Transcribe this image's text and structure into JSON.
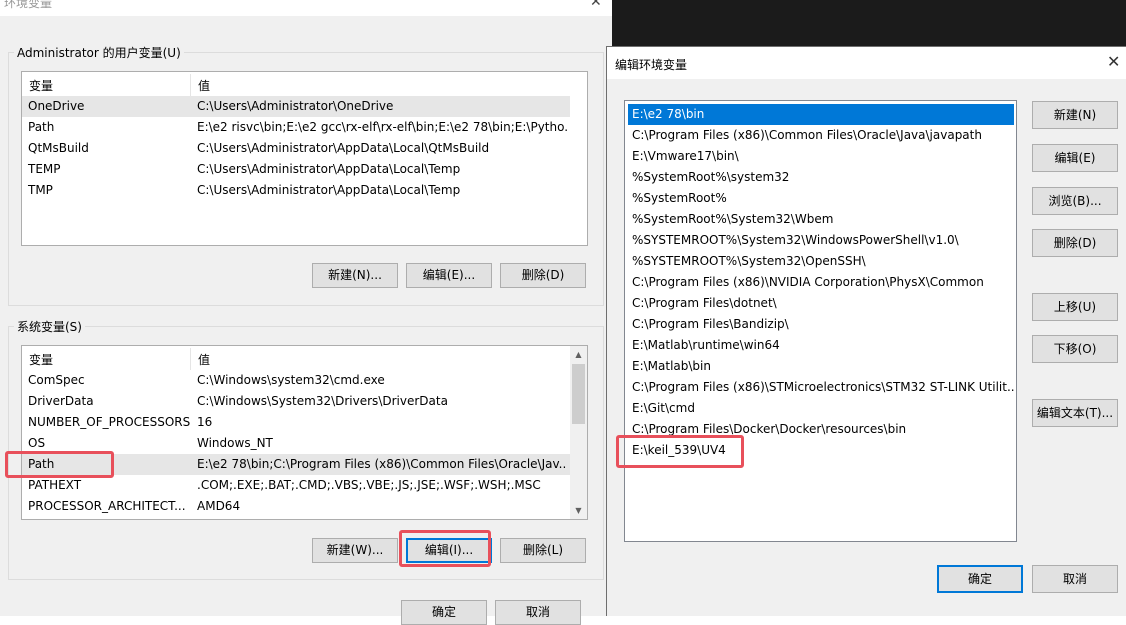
{
  "env_window": {
    "title": "环境变量",
    "close_glyph": "✕",
    "user_group_label": "Administrator 的用户变量(U)",
    "columns": [
      "变量",
      "值"
    ],
    "user_vars": [
      {
        "name": "OneDrive",
        "value": "C:\\Users\\Administrator\\OneDrive"
      },
      {
        "name": "Path",
        "value": "E:\\e2 risvc\\bin;E:\\e2 gcc\\rx-elf\\rx-elf\\bin;E:\\e2 78\\bin;E:\\Pytho..."
      },
      {
        "name": "QtMsBuild",
        "value": "C:\\Users\\Administrator\\AppData\\Local\\QtMsBuild"
      },
      {
        "name": "TEMP",
        "value": "C:\\Users\\Administrator\\AppData\\Local\\Temp"
      },
      {
        "name": "TMP",
        "value": "C:\\Users\\Administrator\\AppData\\Local\\Temp"
      }
    ],
    "user_buttons": {
      "new": "新建(N)...",
      "edit": "编辑(E)...",
      "delete": "删除(D)"
    },
    "system_group_label": "系统变量(S)",
    "system_vars": [
      {
        "name": "ComSpec",
        "value": "C:\\Windows\\system32\\cmd.exe"
      },
      {
        "name": "DriverData",
        "value": "C:\\Windows\\System32\\Drivers\\DriverData"
      },
      {
        "name": "NUMBER_OF_PROCESSORS",
        "value": "16"
      },
      {
        "name": "OS",
        "value": "Windows_NT"
      },
      {
        "name": "Path",
        "value": "E:\\e2 78\\bin;C:\\Program Files (x86)\\Common Files\\Oracle\\Jav..."
      },
      {
        "name": "PATHEXT",
        "value": ".COM;.EXE;.BAT;.CMD;.VBS;.VBE;.JS;.JSE;.WSF;.WSH;.MSC"
      },
      {
        "name": "PROCESSOR_ARCHITECT...",
        "value": "AMD64"
      }
    ],
    "system_buttons": {
      "new": "新建(W)...",
      "edit": "编辑(I)...",
      "delete": "删除(L)"
    },
    "ok": "确定",
    "cancel": "取消"
  },
  "edit_dialog": {
    "title": "编辑环境变量",
    "close_glyph": "✕",
    "entries": [
      "E:\\e2 78\\bin",
      "C:\\Program Files (x86)\\Common Files\\Oracle\\Java\\javapath",
      "E:\\Vmware17\\bin\\",
      "%SystemRoot%\\system32",
      "%SystemRoot%",
      "%SystemRoot%\\System32\\Wbem",
      "%SYSTEMROOT%\\System32\\WindowsPowerShell\\v1.0\\",
      "%SYSTEMROOT%\\System32\\OpenSSH\\",
      "C:\\Program Files (x86)\\NVIDIA Corporation\\PhysX\\Common",
      "C:\\Program Files\\dotnet\\",
      "C:\\Program Files\\Bandizip\\",
      "E:\\Matlab\\runtime\\win64",
      "E:\\Matlab\\bin",
      "C:\\Program Files (x86)\\STMicroelectronics\\STM32 ST-LINK Utilit...",
      "E:\\Git\\cmd",
      "C:\\Program Files\\Docker\\Docker\\resources\\bin",
      "E:\\keil_539\\UV4"
    ],
    "buttons": {
      "new": "新建(N)",
      "edit": "编辑(E)",
      "browse": "浏览(B)...",
      "delete": "删除(D)",
      "move_up": "上移(U)",
      "move_down": "下移(O)",
      "edit_text": "编辑文本(T)..."
    },
    "ok": "确定",
    "cancel": "取消"
  },
  "colors": {
    "highlight": "#e8505b",
    "selection": "#0078d7"
  }
}
